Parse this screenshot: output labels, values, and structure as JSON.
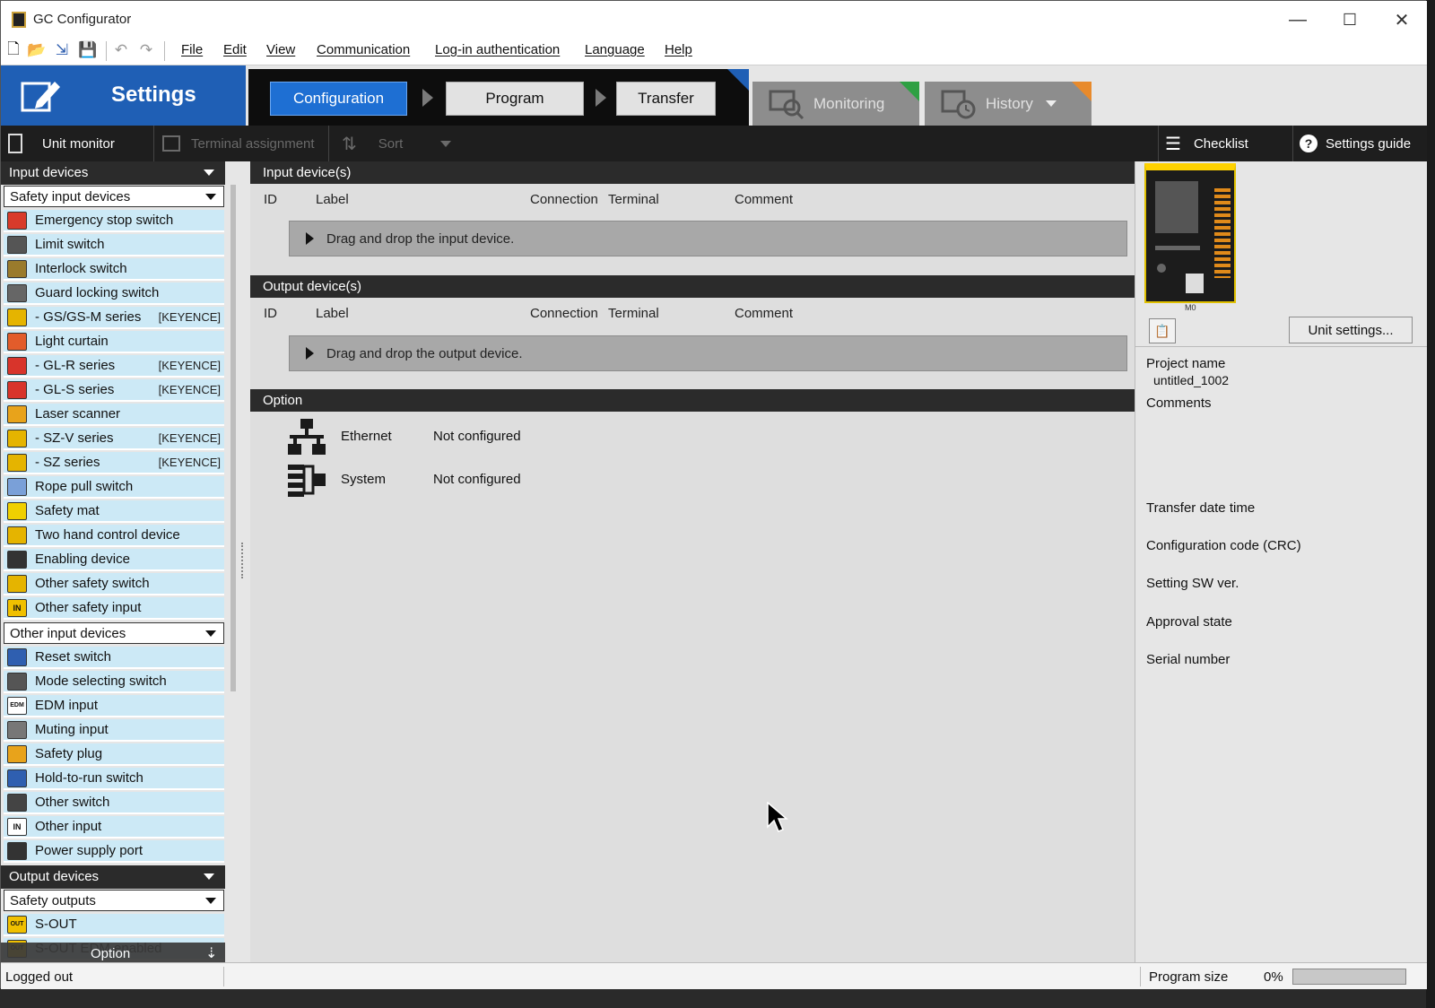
{
  "window": {
    "title": "GC Configurator",
    "minimize": "—",
    "maximize": "☐",
    "close": "✕"
  },
  "menu": [
    "File",
    "Edit",
    "View",
    "Communication",
    "Log-in authentication",
    "Language",
    "Help"
  ],
  "header": {
    "settings_label": "Settings",
    "flow": [
      "Configuration",
      "Program",
      "Transfer"
    ],
    "monitoring": "Monitoring",
    "history": "History"
  },
  "toolstrip": {
    "unit_monitor": "Unit monitor",
    "terminal_assignment": "Terminal assignment",
    "sort": "Sort",
    "checklist": "Checklist",
    "settings_guide": "Settings guide"
  },
  "left": {
    "input_devices_header": "Input devices",
    "safety_input_dropdown": "Safety input devices",
    "safety_inputs": [
      {
        "label": "Emergency stop switch",
        "tag": "",
        "color": "#d83b2b"
      },
      {
        "label": "Limit switch",
        "tag": "",
        "color": "#555555"
      },
      {
        "label": "Interlock switch",
        "tag": "",
        "color": "#9a7b2c"
      },
      {
        "label": "Guard locking switch",
        "tag": "",
        "color": "#666666"
      },
      {
        "label": "- GS/GS-M series",
        "tag": "[KEYENCE]",
        "color": "#e5b400"
      },
      {
        "label": "Light curtain",
        "tag": "",
        "color": "#e25c2b"
      },
      {
        "label": "- GL-R series",
        "tag": "[KEYENCE]",
        "color": "#d8342b"
      },
      {
        "label": "- GL-S series",
        "tag": "[KEYENCE]",
        "color": "#d8342b"
      },
      {
        "label": "Laser scanner",
        "tag": "",
        "color": "#e8a31b"
      },
      {
        "label": "- SZ-V series",
        "tag": "[KEYENCE]",
        "color": "#e5b400"
      },
      {
        "label": "- SZ series",
        "tag": "[KEYENCE]",
        "color": "#e5b400"
      },
      {
        "label": "Rope pull switch",
        "tag": "",
        "color": "#7aa0d8"
      },
      {
        "label": "Safety mat",
        "tag": "",
        "color": "#f0d000"
      },
      {
        "label": "Two hand control device",
        "tag": "",
        "color": "#e5b400"
      },
      {
        "label": "Enabling device",
        "tag": "",
        "color": "#333333"
      },
      {
        "label": "Other safety switch",
        "tag": "",
        "color": "#e5b400"
      },
      {
        "label": "Other safety input",
        "tag": "",
        "color": "#f0c000",
        "text": "IN"
      }
    ],
    "other_input_dropdown": "Other input devices",
    "other_inputs": [
      {
        "label": "Reset switch",
        "tag": "",
        "color": "#2f5fb0"
      },
      {
        "label": "Mode selecting switch",
        "tag": "",
        "color": "#555555"
      },
      {
        "label": "EDM input",
        "tag": "",
        "color": "#ffffff",
        "text": "EDM"
      },
      {
        "label": "Muting input",
        "tag": "",
        "color": "#777777"
      },
      {
        "label": "Safety plug",
        "tag": "",
        "color": "#e8a31b"
      },
      {
        "label": "Hold-to-run switch",
        "tag": "",
        "color": "#2f5fb0"
      },
      {
        "label": "Other switch",
        "tag": "",
        "color": "#444444"
      },
      {
        "label": "Other input",
        "tag": "",
        "color": "#ffffff",
        "text": "IN"
      },
      {
        "label": "Power supply port",
        "tag": "",
        "color": "#333333"
      }
    ],
    "output_devices_header": "Output devices",
    "safety_outputs_dropdown": "Safety outputs",
    "outputs": [
      {
        "label": "S-OUT",
        "tag": "",
        "color": "#f0c000",
        "text": "OUT"
      },
      {
        "label": "S-OUT EDM enabled",
        "tag": "",
        "color": "#f0c000",
        "text": "OUT"
      }
    ],
    "option_bar": "Option"
  },
  "center": {
    "input_header": "Input device(s)",
    "output_header": "Output device(s)",
    "columns": [
      "ID",
      "Label",
      "Connection",
      "Terminal",
      "Comment"
    ],
    "input_drop": "Drag and drop the input device.",
    "output_drop": "Drag and drop the output device.",
    "option_header": "Option",
    "options": [
      {
        "name": "Ethernet",
        "status": "Not configured"
      },
      {
        "name": "System",
        "status": "Not configured"
      }
    ]
  },
  "right": {
    "device_model": "M0",
    "unit_settings": "Unit settings...",
    "project_name_label": "Project name",
    "project_name": "untitled_1002",
    "comments_label": "Comments",
    "transfer_date_time": "Transfer date time",
    "configuration_code": "Configuration code (CRC)",
    "setting_sw_ver": "Setting SW ver.",
    "approval_state": "Approval state",
    "serial_number": "Serial number"
  },
  "status": {
    "login": "Logged out",
    "program_size_label": "Program size",
    "program_size_value": "0%",
    "program_size_fraction": 0
  }
}
